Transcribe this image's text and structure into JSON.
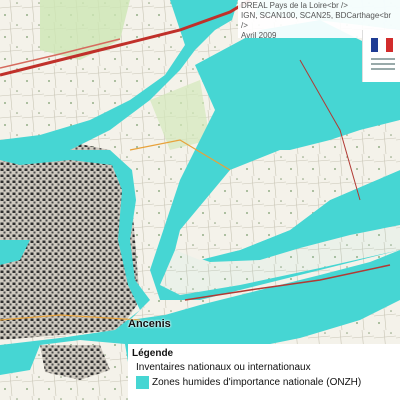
{
  "credits": {
    "line1": "DREAL Pays de la Loire<br />",
    "line2": "IGN, SCAN100, SCAN25, BDCarthage<br />",
    "line3": "Avril 2009"
  },
  "town_label": "Ancenis",
  "legend": {
    "title": "Légende",
    "group": "Inventaires nationaux ou internationaux",
    "item": "Zones humides d'importance nationale (ONZH)",
    "item_color": "#46d6d3"
  },
  "colors": {
    "wetland": "#46d6d3",
    "background": "#f4f2ea",
    "urban": "#3a3a3a",
    "road": "#c0302a"
  },
  "logo": {
    "icon": "french-republic-flag-icon"
  }
}
